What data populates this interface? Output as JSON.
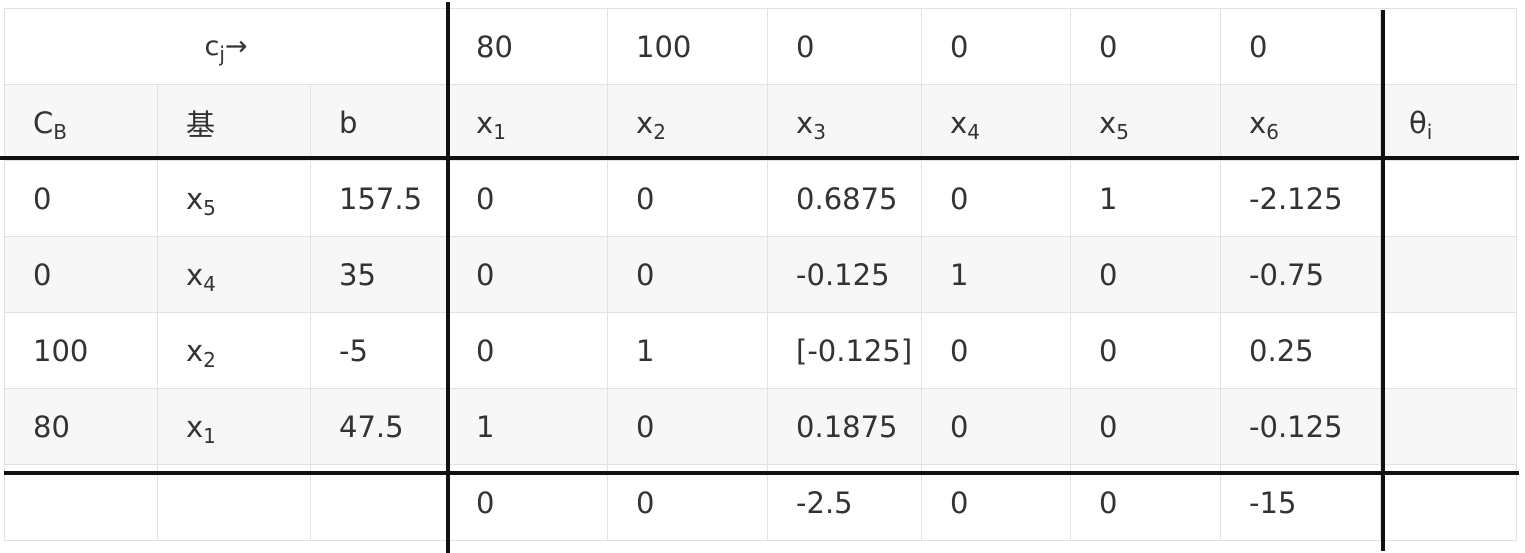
{
  "table": {
    "cj_row": {
      "label": "cj→",
      "label_main": "c",
      "label_sub": "j",
      "label_arrow": "→",
      "values": [
        "80",
        "100",
        "0",
        "0",
        "0",
        "0"
      ]
    },
    "header": {
      "cb": {
        "main": "C",
        "sub": "B"
      },
      "basis": "基",
      "b": "b",
      "vars": [
        {
          "main": "x",
          "sub": "1"
        },
        {
          "main": "x",
          "sub": "2"
        },
        {
          "main": "x",
          "sub": "3"
        },
        {
          "main": "x",
          "sub": "4"
        },
        {
          "main": "x",
          "sub": "5"
        },
        {
          "main": "x",
          "sub": "6"
        }
      ],
      "theta": {
        "main": "θ",
        "sub": "i"
      }
    },
    "rows": [
      {
        "cb": "0",
        "basis": {
          "main": "x",
          "sub": "5"
        },
        "b": "157.5",
        "values": [
          "0",
          "0",
          "0.6875",
          "0",
          "1",
          "-2.125"
        ],
        "theta": ""
      },
      {
        "cb": "0",
        "basis": {
          "main": "x",
          "sub": "4"
        },
        "b": "35",
        "values": [
          "0",
          "0",
          "-0.125",
          "1",
          "0",
          "-0.75"
        ],
        "theta": ""
      },
      {
        "cb": "100",
        "basis": {
          "main": "x",
          "sub": "2"
        },
        "b": "-5",
        "values": [
          "0",
          "1",
          "[-0.125]",
          "0",
          "0",
          "0.25"
        ],
        "theta": ""
      },
      {
        "cb": "80",
        "basis": {
          "main": "x",
          "sub": "1"
        },
        "b": "47.5",
        "values": [
          "1",
          "0",
          "0.1875",
          "0",
          "0",
          "-0.125"
        ],
        "theta": ""
      }
    ],
    "check_row": {
      "cb": "",
      "basis": "",
      "b": "",
      "values": [
        "0",
        "0",
        "-2.5",
        "0",
        "0",
        "-15"
      ],
      "theta": ""
    }
  }
}
